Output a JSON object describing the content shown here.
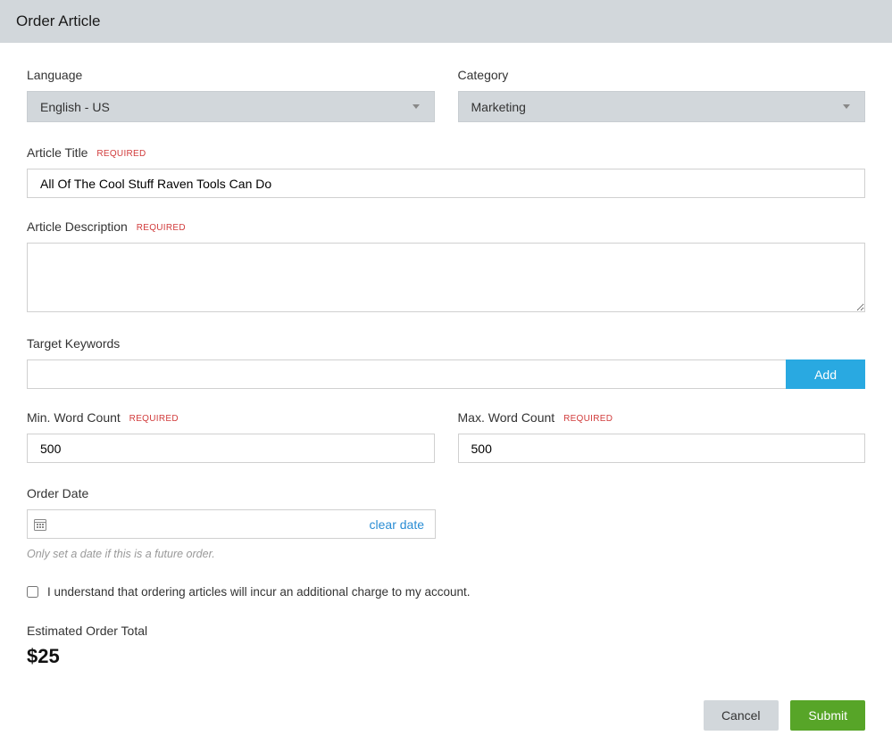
{
  "header": {
    "title": "Order Article"
  },
  "form": {
    "language": {
      "label": "Language",
      "value": "English - US"
    },
    "category": {
      "label": "Category",
      "value": "Marketing"
    },
    "article_title": {
      "label": "Article Title",
      "required": "REQUIRED",
      "value": "All Of The Cool Stuff Raven Tools Can Do"
    },
    "article_description": {
      "label": "Article Description",
      "required": "REQUIRED",
      "value": ""
    },
    "target_keywords": {
      "label": "Target Keywords",
      "value": "",
      "add_btn": "Add"
    },
    "min_word": {
      "label": "Min. Word Count",
      "required": "REQUIRED",
      "value": "500"
    },
    "max_word": {
      "label": "Max. Word Count",
      "required": "REQUIRED",
      "value": "500"
    },
    "order_date": {
      "label": "Order Date",
      "value": "",
      "clear": "clear date",
      "hint": "Only set a date if this is a future order."
    },
    "consent": {
      "text": "I understand that ordering articles will incur an additional charge to my account."
    },
    "total": {
      "label": "Estimated Order Total",
      "value": "$25"
    }
  },
  "actions": {
    "cancel": "Cancel",
    "submit": "Submit"
  }
}
